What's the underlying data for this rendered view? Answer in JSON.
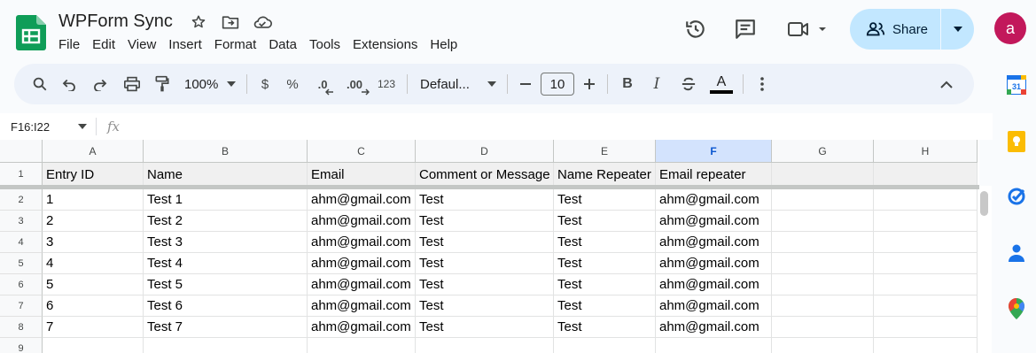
{
  "app": {
    "title": "WPForm Sync",
    "menu": [
      "File",
      "Edit",
      "View",
      "Insert",
      "Format",
      "Data",
      "Tools",
      "Extensions",
      "Help"
    ],
    "share_label": "Share",
    "avatar_letter": "a"
  },
  "toolbar": {
    "zoom": "100%",
    "currency": "$",
    "percent": "%",
    "decimal_decrease": ".0",
    "decimal_increase": ".00",
    "number_format": "123",
    "font_family": "Defaul...",
    "font_size": "10",
    "bold": "B",
    "italic": "I",
    "text_color": "A"
  },
  "formula_bar": {
    "name_box": "F16:I22",
    "fx": "fx"
  },
  "sheet": {
    "columns": [
      "A",
      "B",
      "C",
      "D",
      "E",
      "F",
      "G",
      "H"
    ],
    "selected_column": "F",
    "row_numbers": [
      "1",
      "2",
      "3",
      "4",
      "5",
      "6",
      "7",
      "8",
      "9"
    ],
    "rows": [
      [
        "Entry ID",
        "Name",
        "Email",
        "Comment or Message",
        "Name Repeater",
        "Email repeater",
        "",
        ""
      ],
      [
        "1",
        "Test 1",
        "ahm@gmail.com",
        "Test",
        "Test",
        "ahm@gmail.com",
        "",
        ""
      ],
      [
        "2",
        "Test 2",
        "ahm@gmail.com",
        "Test",
        "Test",
        "ahm@gmail.com",
        "",
        ""
      ],
      [
        "3",
        "Test 3",
        "ahm@gmail.com",
        "Test",
        "Test",
        "ahm@gmail.com",
        "",
        ""
      ],
      [
        "4",
        "Test 4",
        "ahm@gmail.com",
        "Test",
        "Test",
        "ahm@gmail.com",
        "",
        ""
      ],
      [
        "5",
        "Test 5",
        "ahm@gmail.com",
        "Test",
        "Test",
        "ahm@gmail.com",
        "",
        ""
      ],
      [
        "6",
        "Test 6",
        "ahm@gmail.com",
        "Test",
        "Test",
        "ahm@gmail.com",
        "",
        ""
      ],
      [
        "7",
        "Test 7",
        "ahm@gmail.com",
        "Test",
        "Test",
        "ahm@gmail.com",
        "",
        ""
      ],
      [
        "",
        "",
        "",
        "",
        "",
        "",
        "",
        ""
      ]
    ]
  },
  "side_panel": {
    "icons": [
      "calendar-icon",
      "keep-icon",
      "tasks-icon",
      "contacts-icon",
      "maps-icon"
    ],
    "calendar_day": "31"
  },
  "colors": {
    "sheets_green": "#0f9d58",
    "share_bg": "#c2e7ff",
    "avatar": "#c2185b",
    "selected_col": "#d3e3fd"
  }
}
